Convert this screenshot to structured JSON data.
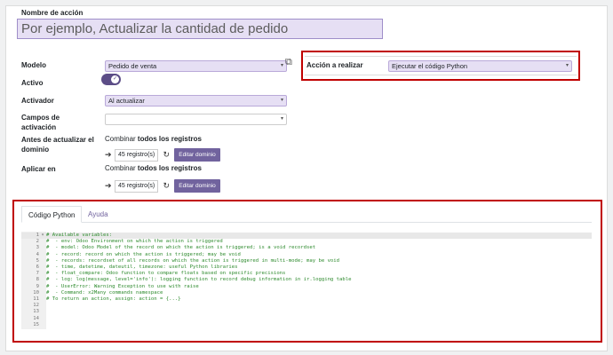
{
  "form": {
    "name_label": "Nombre de acción",
    "name_placeholder": "Por ejemplo, Actualizar la cantidad de pedido",
    "model_label": "Modelo",
    "model_value": "Pedido de venta",
    "active_label": "Activo",
    "trigger_label": "Activador",
    "trigger_value": "Al actualizar",
    "trigger_fields_label_1": "Campos de",
    "trigger_fields_label_2": "activación",
    "before_update_label_1": "Antes de actualizar el",
    "before_update_label_2": "dominio",
    "before_combine_prefix": "Combinar",
    "before_combine_bold": "todos los registros",
    "before_count": "45 registro(s)",
    "edit_domain_label": "Editar dominio",
    "apply_on_label": "Aplicar en",
    "apply_combine_prefix": "Combinar",
    "apply_combine_bold": "todos los registros",
    "apply_count": "45 registro(s)",
    "action_label": "Acción a realizar",
    "action_value": "Ejecutar el código Python"
  },
  "tabs": [
    {
      "label": "Código Python",
      "active": true
    },
    {
      "label": "Ayuda",
      "active": false
    }
  ],
  "editor": {
    "lines": [
      {
        "no": "1",
        "fold": "▾",
        "text": "# Available variables:"
      },
      {
        "no": "2",
        "fold": "",
        "text": "#  - env: Odoo Environment on which the action is triggered"
      },
      {
        "no": "3",
        "fold": "",
        "text": "#  - model: Odoo Model of the record on which the action is triggered; is a void recordset"
      },
      {
        "no": "4",
        "fold": "",
        "text": "#  - record: record on which the action is triggered; may be void"
      },
      {
        "no": "5",
        "fold": "",
        "text": "#  - records: recordset of all records on which the action is triggered in multi-mode; may be void"
      },
      {
        "no": "6",
        "fold": "",
        "text": "#  - time, datetime, dateutil, timezone: useful Python libraries"
      },
      {
        "no": "7",
        "fold": "",
        "text": "#  - float_compare: Odoo function to compare floats based on specific precisions"
      },
      {
        "no": "8",
        "fold": "",
        "text": "#  - log: log(message, level='info'): logging function to record debug information in ir.logging table"
      },
      {
        "no": "9",
        "fold": "",
        "text": "#  - UserError: Warning Exception to use with raise"
      },
      {
        "no": "10",
        "fold": "",
        "text": "#  - Command: x2Many commands namespace"
      },
      {
        "no": "11",
        "fold": "",
        "text": "# To return an action, assign: action = {...}"
      },
      {
        "no": "12",
        "fold": "",
        "text": ""
      },
      {
        "no": "13",
        "fold": "",
        "text": ""
      },
      {
        "no": "14",
        "fold": "",
        "text": ""
      },
      {
        "no": "15",
        "fold": "",
        "text": ""
      }
    ]
  },
  "colors": {
    "accent": "#71639e",
    "highlight_box": "#c00000",
    "input_bg": "#e6dff4"
  },
  "icons": [
    "external-link-icon",
    "check-icon",
    "arrow-right-icon",
    "refresh-icon",
    "caret-down-icon"
  ]
}
